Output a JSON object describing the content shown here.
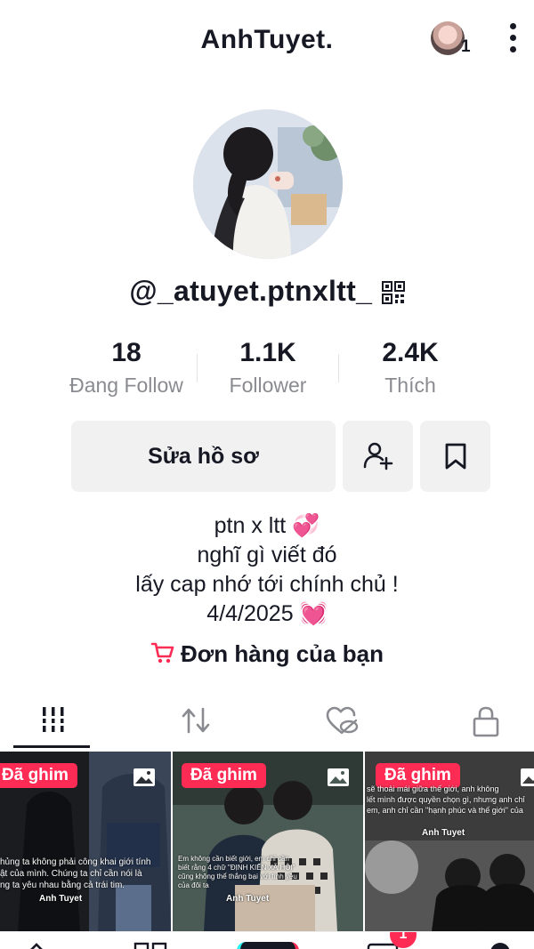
{
  "header": {
    "title": "AnhTuyet.",
    "account_badge": "1"
  },
  "profile": {
    "username": "@_atuyet.ptnxltt_"
  },
  "stats": [
    {
      "value": "18",
      "label": "Đang Follow"
    },
    {
      "value": "1.1K",
      "label": "Follower"
    },
    {
      "value": "2.4K",
      "label": "Thích"
    }
  ],
  "actions": {
    "edit_profile_label": "Sửa hồ sơ"
  },
  "bio": {
    "line1": "ptn x ltt 💞",
    "line2": "nghĩ gì viết đó",
    "line3": "lấy cap nhớ tới chính chủ !",
    "line4": "4/4/2025 💓"
  },
  "orders_label": "Đơn hàng của bạn",
  "tabs": [
    {
      "icon": "grid-icon"
    },
    {
      "icon": "repost-icon"
    },
    {
      "icon": "liked-hidden-icon"
    },
    {
      "icon": "lock-icon"
    }
  ],
  "posts": [
    {
      "pinned_label": "Đã ghim",
      "caption": "hủng ta không phải công khai giới tính\nật của mình. Chúng ta chỉ cần nói là\nng ta yêu nhau bằng cả trái tim.",
      "signature": "Anh Tuyet"
    },
    {
      "pinned_label": "Đã ghim",
      "caption": "Em không cần biết giới, em chỉ cần\nbiết rằng 4 chữ \"ĐỊNH KIẾN XÃ HỘI\"\ncũng không thể thắng bại với tình yêu\ncủa đôi ta",
      "signature": "Anh Tuyet"
    },
    {
      "pinned_label": "Đã ghim",
      "caption": "sẽ thoải mái giữa thế giới, anh không\nlết mình được quyền chọn gì, nhưng anh chỉ\nem, anh chỉ cần \"hạnh phúc và thế giới\" của",
      "signature": "Anh Tuyet"
    }
  ],
  "bottom_nav": {
    "inbox_badge": "1"
  },
  "colors": {
    "accent": "#fe2c55",
    "text": "#161823",
    "muted": "#8a8b91",
    "button_bg": "#f1f1f2"
  }
}
